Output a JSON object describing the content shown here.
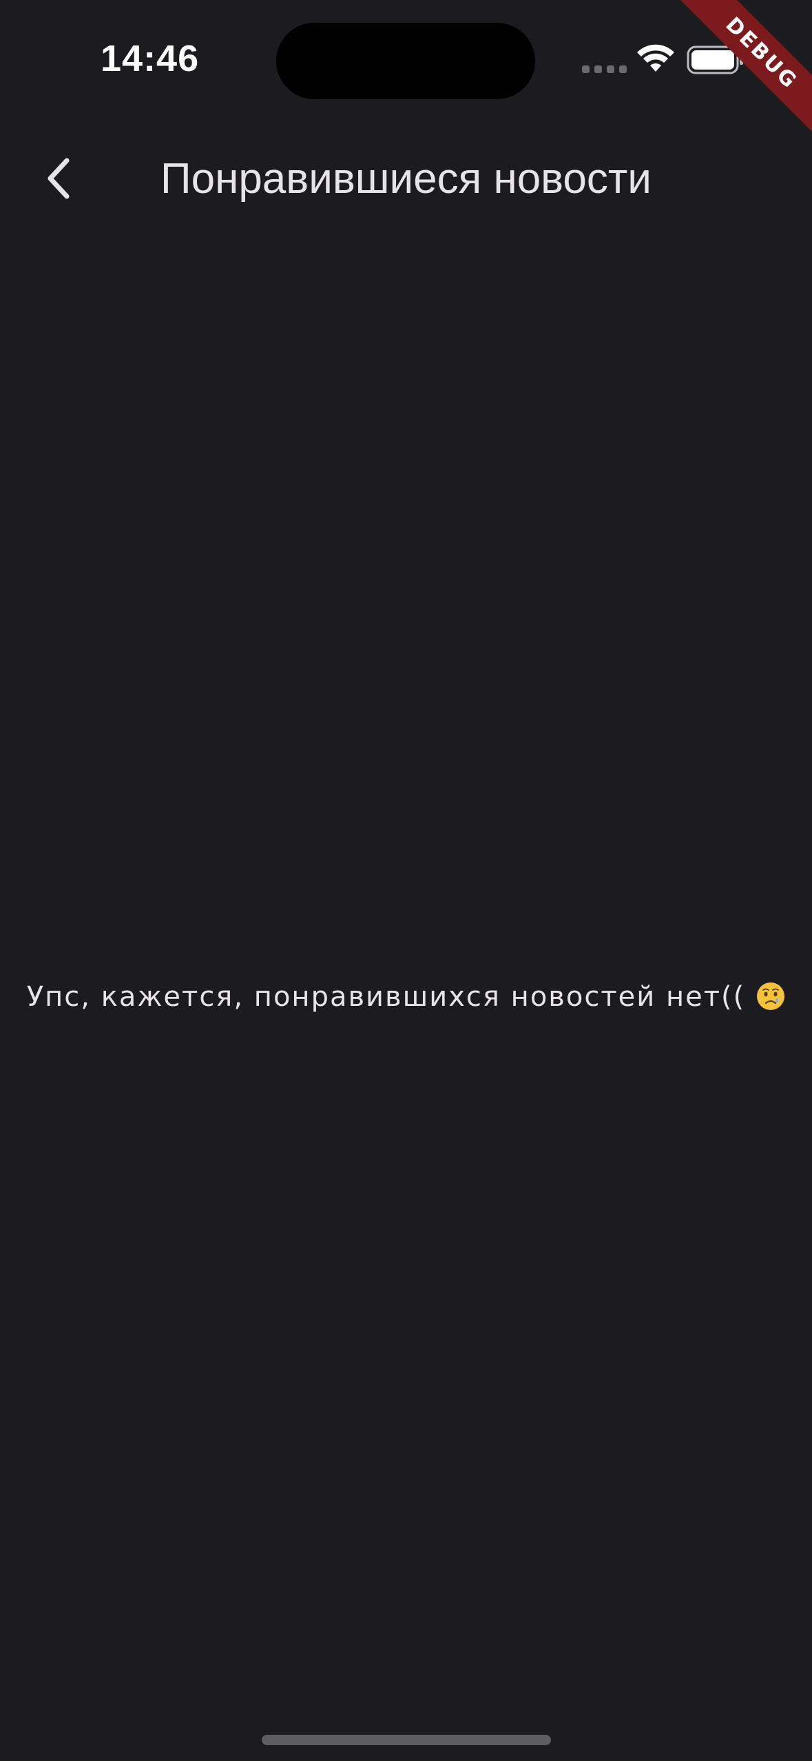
{
  "status_bar": {
    "time": "14:46",
    "wifi_icon": "wifi-icon",
    "battery_icon": "battery-icon",
    "signal_icon": "cellular-signal-icon"
  },
  "debug_banner": {
    "label": "DEBUG",
    "color": "#7c1a1e"
  },
  "app_bar": {
    "back_icon": "chevron-left-icon",
    "title": "Понравившиеся новости"
  },
  "empty_state": {
    "message": "Упс, кажется, понравившихся новостей нет((",
    "emoji": "crying-face-emoji"
  },
  "colors": {
    "background": "#1c1b20",
    "text": "#e6e3ea"
  }
}
